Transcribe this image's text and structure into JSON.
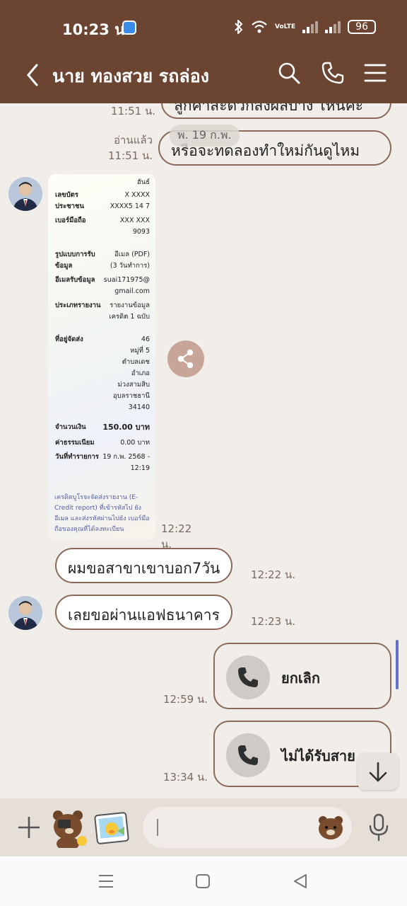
{
  "status_bar": {
    "time": "10:23 น.",
    "battery": "96"
  },
  "header": {
    "contact_name": "นาย ทองสวย รถล่อง"
  },
  "chat": {
    "date_pill": "พ. 19 ก.พ.",
    "msg_top": {
      "text": "ลูกค้าสะดวกส่งผลบ้าง ไหนคะ",
      "time": "11:51 น."
    },
    "msg_retry": {
      "text": "หรือจะทดลองทำใหม่กันดูไหม",
      "read": "อ่านแล้ว",
      "time": "11:51 น."
    },
    "receipt": {
      "time": "12:22 น.",
      "rows": [
        {
          "label": "",
          "value": "ฮันธ์"
        },
        {
          "label": "เลขบัตร",
          "value": "X XXXX"
        },
        {
          "label": "ประชาชน",
          "value": "XXXX5 14 7"
        },
        {
          "label": "เบอร์มือถือ",
          "value": "XXX XXX"
        },
        {
          "label": "",
          "value": "9093"
        },
        {
          "label": "รูปแบบการรับ",
          "value": "อีเมล (PDF)"
        },
        {
          "label": "ข้อมูล",
          "value": "(3 วันทำการ)"
        },
        {
          "label": "อีเมลรับข้อมูล",
          "value": "suai171975@"
        },
        {
          "label": "",
          "value": "gmail.com"
        },
        {
          "label": "ประเภทรายงาน",
          "value": "รายงานข้อมูล"
        },
        {
          "label": "",
          "value": "เครดิต 1 ฉบับ"
        },
        {
          "label": "ที่อยู่จัดส่ง",
          "value": "46"
        },
        {
          "label": "",
          "value": "หมู่ที่ 5"
        },
        {
          "label": "",
          "value": "ตำบลเดช"
        },
        {
          "label": "",
          "value": "อำเภอ"
        },
        {
          "label": "",
          "value": "ม่วงสามสิบ"
        },
        {
          "label": "",
          "value": "อุบลราชธานี"
        },
        {
          "label": "",
          "value": "34140"
        },
        {
          "label": "จำนวนเงิน",
          "value": "150.00 บาท"
        },
        {
          "label": "ค่าธรรมเนียม",
          "value": "0.00 บาท"
        },
        {
          "label": "วันที่ทำรายการ",
          "value": "19 ก.พ. 2568 -"
        },
        {
          "label": "",
          "value": "12:19"
        }
      ],
      "note": "เครดิตบูโรจะจัดส่งรายงาน (E-Credit report) ที่เข้ารหัสไป ยังอีเมล และส่งรหัสผ่านไปยัง เบอร์มือถือของคุณที่ได้ลงทะเบียน"
    },
    "msg_branch": {
      "text": "ผมขอสาขาเขาบอก7วัน",
      "time": "12:22 น."
    },
    "msg_app": {
      "text": "เลยขอผ่านแอฟธนาคาร",
      "time": "12:23 น."
    },
    "call_cancel": {
      "label": "ยกเลิก",
      "time": "12:59 น."
    },
    "call_missed": {
      "label": "ไม่ได้รับสาย",
      "time": "13:34 น."
    }
  },
  "colors": {
    "header_bg": "#6b4532",
    "chat_bg": "#f1ede8",
    "bubble_border": "#8a6a5a"
  }
}
